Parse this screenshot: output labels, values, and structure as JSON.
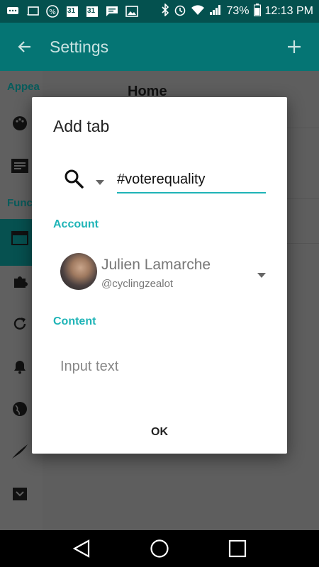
{
  "status_bar": {
    "battery": "73%",
    "time": "12:13 PM",
    "calendar_day_1": "31",
    "calendar_day_2": "31"
  },
  "app_bar": {
    "title": "Settings"
  },
  "background": {
    "sidebar_section_1": "Appea",
    "sidebar_section_2": "Func",
    "home_label": "Home"
  },
  "dialog": {
    "title": "Add tab",
    "query_value": "#voterequality",
    "account_label": "Account",
    "account_name": "Julien Lamarche",
    "account_handle": "@cyclingzealot",
    "content_label": "Content",
    "content_placeholder": "Input text",
    "ok_label": "OK"
  },
  "colors": {
    "accent": "#1fb4b7",
    "app_bar": "#057574",
    "status_bar": "#04514f"
  }
}
